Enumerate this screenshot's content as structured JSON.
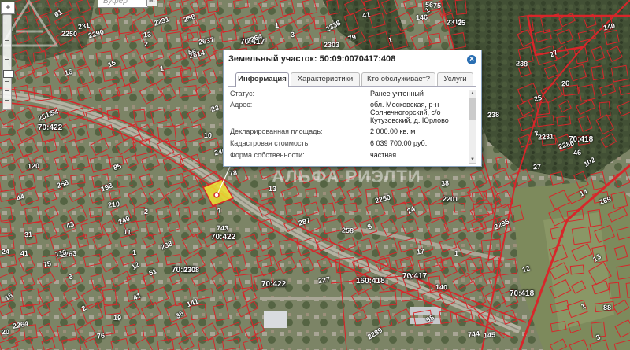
{
  "search": {
    "placeholder": "Буфер",
    "button_label": "м."
  },
  "zoom": {
    "plus_label": "+"
  },
  "map": {
    "zone_labels": [
      "70:417",
      "70:422",
      "70:422",
      "70:422",
      "70:422",
      "70:418",
      "70:418",
      "160:418",
      "70:417"
    ],
    "parcel_labels": [
      "2201",
      "2303",
      "2231",
      "2308",
      "2263",
      "2518",
      "2289",
      "2290",
      "2250",
      "2231",
      "2286",
      "2250",
      "11",
      "16",
      "10",
      "8",
      "13",
      "1",
      "2",
      "13",
      "1",
      "23",
      "27",
      "17",
      "85",
      "98",
      "75",
      "46",
      "2295",
      "2310",
      "231",
      "2264",
      "289",
      "36",
      "38",
      "140",
      "61",
      "75",
      "2614",
      "2637",
      "2338",
      "240",
      "240",
      "3",
      "258",
      "258",
      "1",
      "238",
      "238",
      "24",
      "146",
      "141",
      "14",
      "120",
      "140",
      "1",
      "2",
      "76",
      "16",
      "25",
      "31",
      "78",
      "19",
      "2",
      "25",
      "41",
      "1",
      "12",
      "2",
      "20",
      "26",
      "7",
      "3",
      "12",
      "16",
      "41",
      "44",
      "79",
      "113",
      "88",
      "56",
      "1",
      "8",
      "1",
      "41",
      "56",
      "43",
      "1",
      "54",
      "227",
      "287",
      "258",
      "238",
      "2264",
      "51",
      "743",
      "744",
      "27",
      "210",
      "24",
      "145",
      "13",
      "102",
      "198"
    ]
  },
  "watermark": {
    "text": "АЛЬФА РИЭЛТИ"
  },
  "popup": {
    "title": "Земельный участок: 50:09:0070417:408",
    "close_label": "×",
    "tabs": [
      {
        "label": "Информация",
        "active": true
      },
      {
        "label": "Характеристики",
        "active": false
      },
      {
        "label": "Кто обслуживает?",
        "active": false
      },
      {
        "label": "Услуги",
        "active": false
      }
    ],
    "rows": [
      {
        "label": "Статус:",
        "value": "Ранее учтенный"
      },
      {
        "label": "Адрес:",
        "value": "обл. Московская, р-н Солнечногорский, с/о Кутузовский, д. Юрлово"
      },
      {
        "label": "Декларированная площадь:",
        "value": "2 000.00 кв. м"
      },
      {
        "label": "Кадастровая стоимость:",
        "value": "6 039 700.00 руб."
      },
      {
        "label": "Форма собственности:",
        "value": "частная"
      }
    ]
  },
  "colors": {
    "boundary": "#d8262a",
    "road": "#9a9a8e",
    "forest": "#3d4a33",
    "field": "#6f7c54",
    "accent": "#2a6fb3"
  }
}
